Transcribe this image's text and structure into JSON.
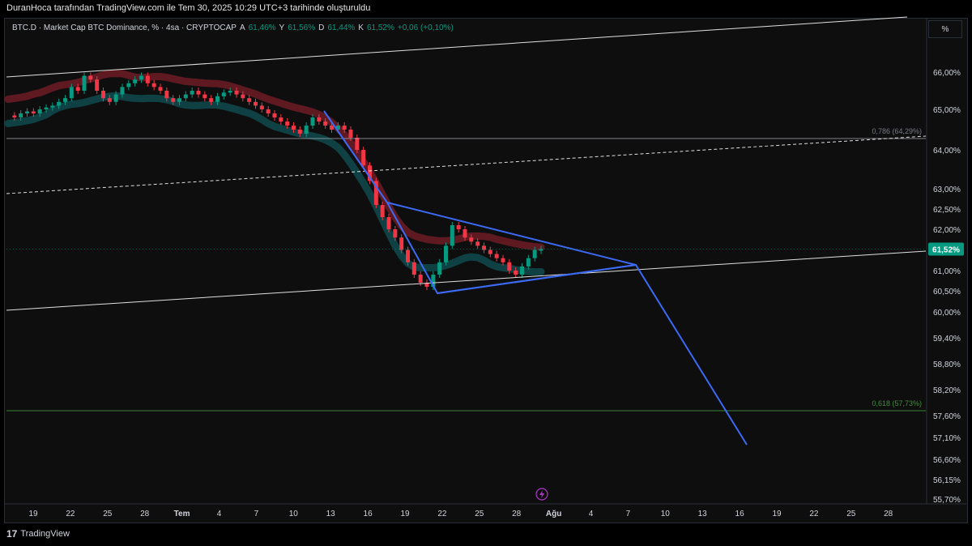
{
  "caption": "DuranHoca tarafından TradingView.com ile Tem 30, 2025 10:29 UTC+3 tarihinde oluşturuldu",
  "legend": {
    "symbol": "BTC.D · Market Cap BTC Dominance, % · 4sa · CRYPTOCAP",
    "a_label": "A",
    "a_value": "61,46%",
    "y_label": "Y",
    "y_value": "61,56%",
    "d_label": "D",
    "d_value": "61,44%",
    "k_label": "K",
    "k_value": "61,52%",
    "change": "+0,06 (+0,10%)"
  },
  "unit_button": "%",
  "footer": {
    "logo": "17",
    "brand": "TradingView"
  },
  "colors": {
    "up": "#089981",
    "down": "#f23645",
    "trend": "#3d6af5",
    "red_band": "#7a1e28",
    "teal_band": "#0f4a4e",
    "green_level": "#3f8f3a",
    "price_badge": "#089981"
  },
  "chart_data": {
    "type": "candlestick",
    "y_axis": {
      "ticks": [
        "66,00%",
        "65,00%",
        "64,00%",
        "63,00%",
        "62,50%",
        "62,00%",
        "61,00%",
        "60,50%",
        "60,00%",
        "59,40%",
        "58,80%",
        "58,20%",
        "57,60%",
        "57,10%",
        "56,60%",
        "56,15%",
        "55,70%"
      ],
      "tick_values": [
        66.0,
        65.0,
        64.0,
        63.0,
        62.5,
        62.0,
        61.0,
        60.5,
        60.0,
        59.4,
        58.8,
        58.2,
        57.6,
        57.1,
        56.6,
        56.15,
        55.7
      ],
      "scale": "non-linear"
    },
    "x_axis": {
      "ticks": [
        "19",
        "22",
        "25",
        "28",
        "Tem",
        "4",
        "7",
        "10",
        "13",
        "16",
        "19",
        "22",
        "25",
        "28",
        "Ağu",
        "4",
        "7",
        "10",
        "13",
        "16",
        "19",
        "22",
        "25",
        "28"
      ]
    },
    "last_price_label": "61,52%",
    "last_price": 61.52,
    "fib_levels": [
      {
        "label": "0,786 (64,29%)",
        "value": 64.29
      },
      {
        "label": "0,618 (57,73%)",
        "value": 57.73
      }
    ],
    "candle_closes": [
      64.85,
      64.8,
      64.9,
      64.95,
      64.9,
      65.0,
      65.05,
      65.1,
      65.2,
      65.3,
      65.6,
      65.5,
      65.9,
      65.8,
      65.5,
      65.3,
      65.2,
      65.4,
      65.6,
      65.7,
      65.8,
      65.9,
      65.7,
      65.6,
      65.5,
      65.3,
      65.2,
      65.3,
      65.4,
      65.5,
      65.4,
      65.3,
      65.2,
      65.35,
      65.45,
      65.5,
      65.4,
      65.3,
      65.2,
      65.1,
      65.0,
      64.9,
      64.8,
      64.7,
      64.6,
      64.5,
      64.4,
      64.6,
      64.8,
      64.7,
      64.6,
      64.5,
      64.6,
      64.5,
      64.3,
      64.0,
      63.6,
      63.2,
      62.6,
      62.3,
      62.0,
      61.8,
      61.5,
      61.2,
      60.9,
      60.7,
      60.6,
      60.9,
      61.2,
      61.6,
      62.1,
      62.0,
      61.8,
      61.7,
      61.6,
      61.5,
      61.4,
      61.3,
      61.2,
      61.0,
      60.9,
      61.1,
      61.3,
      61.5,
      61.52
    ],
    "trend_lines": [
      {
        "name": "channel-upper",
        "points": [
          [
            0,
            65.75
          ],
          [
            1,
            67.5
          ]
        ]
      },
      {
        "name": "channel-lower",
        "points": [
          [
            0,
            60.0
          ],
          [
            1,
            61.55
          ]
        ]
      },
      {
        "name": "channel-mid-dashed",
        "points": [
          [
            0,
            62.9
          ],
          [
            1,
            64.32
          ]
        ]
      }
    ],
    "projection_path_values": [
      65.0,
      62.6,
      60.5,
      61.15,
      56.9
    ]
  }
}
